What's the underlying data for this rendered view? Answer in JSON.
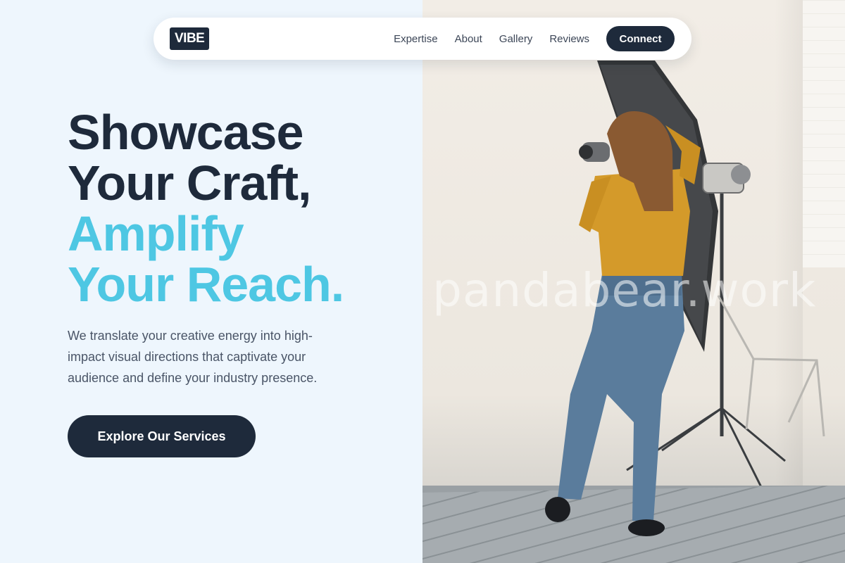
{
  "header": {
    "logo": "VIBE",
    "nav": [
      "Expertise",
      "About",
      "Gallery",
      "Reviews"
    ],
    "cta": "Connect"
  },
  "hero": {
    "heading": {
      "line1": "Showcase",
      "line2": "Your Craft,",
      "line3": "Amplify",
      "line4": "Your Reach."
    },
    "description": "We translate your creative energy into high-impact visual directions that captivate your audience and define your industry presence.",
    "button": "Explore Our Services"
  },
  "image": {
    "watermark": "pandabear.work",
    "subject": "photographer-in-studio-photo"
  },
  "colors": {
    "dark": "#1e2a3b",
    "accent": "#4ec7e3",
    "background": "#eef6fd"
  }
}
